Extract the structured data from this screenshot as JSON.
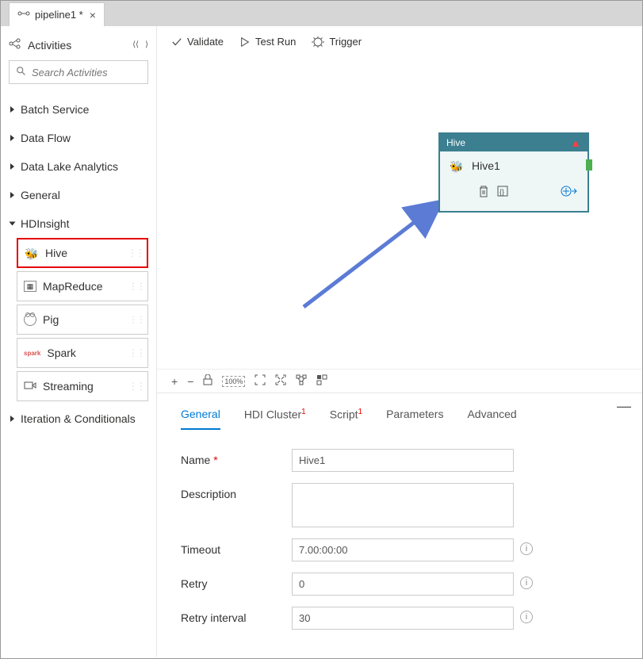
{
  "tab": {
    "title": "pipeline1 *"
  },
  "sidebar": {
    "header": "Activities",
    "search_placeholder": "Search Activities",
    "categories": [
      {
        "label": "Batch Service",
        "open": false
      },
      {
        "label": "Data Flow",
        "open": false
      },
      {
        "label": "Data Lake Analytics",
        "open": false
      },
      {
        "label": "General",
        "open": false
      },
      {
        "label": "HDInsight",
        "open": true,
        "items": [
          {
            "label": "Hive",
            "selected": true,
            "icon": "bee"
          },
          {
            "label": "MapReduce",
            "icon": "box"
          },
          {
            "label": "Pig",
            "icon": "pig"
          },
          {
            "label": "Spark",
            "icon": "spark"
          },
          {
            "label": "Streaming",
            "icon": "stream"
          }
        ]
      },
      {
        "label": "Iteration & Conditionals",
        "open": false
      }
    ]
  },
  "toolbar": {
    "validate": "Validate",
    "testrun": "Test Run",
    "trigger": "Trigger"
  },
  "node": {
    "header": "Hive",
    "title": "Hive1"
  },
  "props": {
    "tabs": {
      "general": "General",
      "hdi": "HDI Cluster",
      "script": "Script",
      "params": "Parameters",
      "advanced": "Advanced"
    },
    "form": {
      "name_label": "Name",
      "name_value": "Hive1",
      "desc_label": "Description",
      "desc_value": "",
      "timeout_label": "Timeout",
      "timeout_value": "7.00:00:00",
      "retry_label": "Retry",
      "retry_value": "0",
      "retry_int_label": "Retry interval",
      "retry_int_value": "30"
    }
  }
}
